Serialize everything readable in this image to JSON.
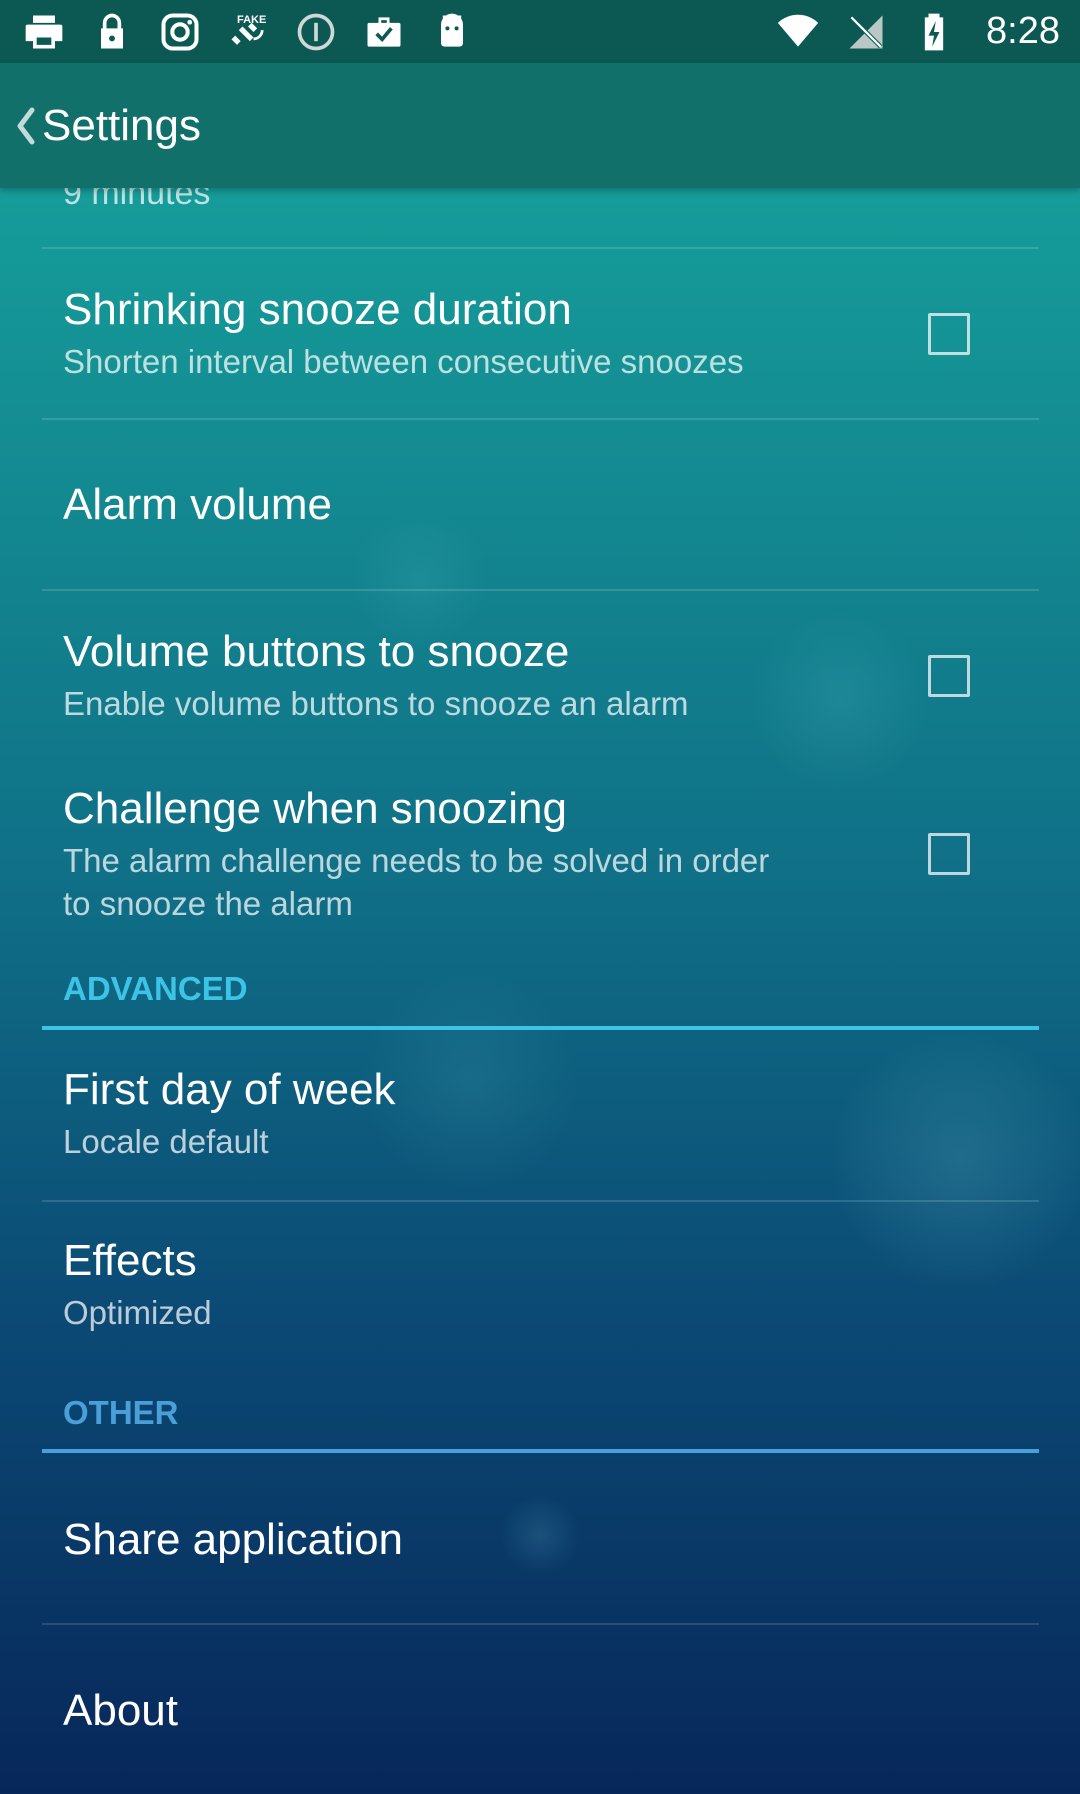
{
  "status_bar": {
    "time": "8:28",
    "left_icons": [
      "printer-icon",
      "lock-icon",
      "instagram-icon",
      "fake-gps-icon",
      "info-icon",
      "briefcase-check-icon",
      "android-icon"
    ],
    "right_icons": [
      "wifi-icon",
      "no-signal-icon",
      "battery-charging-icon"
    ]
  },
  "toolbar": {
    "title": "Settings",
    "back_icon": "chevron-left-icon"
  },
  "preferences": {
    "snooze_duration_summary": "9 minutes",
    "shrinking_snooze": {
      "title": "Shrinking snooze duration",
      "summary": "Shorten interval between consecutive snoozes",
      "checked": false
    },
    "alarm_volume": {
      "title": "Alarm volume"
    },
    "volume_buttons": {
      "title": "Volume buttons to snooze",
      "summary": "Enable volume buttons to snooze an alarm",
      "checked": false
    },
    "challenge_snoozing": {
      "title": "Challenge when snoozing",
      "summary_line1": "The alarm challenge needs to be solved in order",
      "summary_line2": "to snooze the alarm",
      "checked": false
    }
  },
  "advanced": {
    "header": "ADVANCED",
    "first_day": {
      "title": "First day of week",
      "summary": "Locale default"
    },
    "effects": {
      "title": "Effects",
      "summary": "Optimized"
    }
  },
  "other": {
    "header": "OTHER",
    "share": {
      "title": "Share application"
    },
    "about": {
      "title": "About"
    }
  },
  "colors": {
    "advanced_accent": "#3cc3e6",
    "other_accent": "#4a9fd8",
    "status_bar": "#0c5953",
    "toolbar": "#12706a"
  }
}
